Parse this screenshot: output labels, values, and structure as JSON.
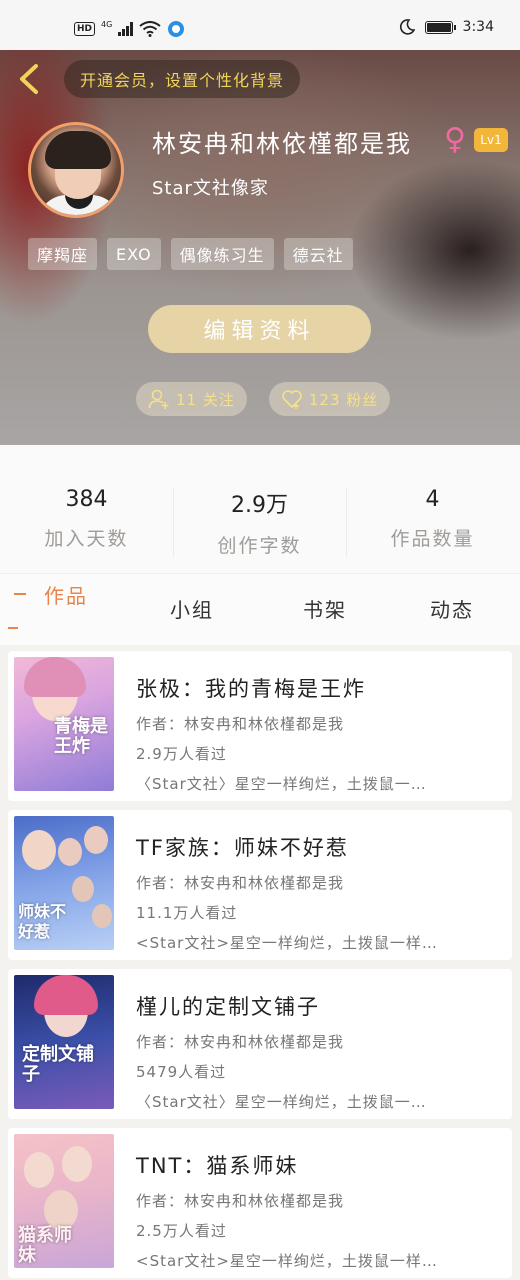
{
  "status_bar": {
    "hd": "HD",
    "network": "4G",
    "time": "3:34"
  },
  "header": {
    "vip_prompt": "开通会员，设置个性化背景",
    "name": "林安冉和林依槿都是我",
    "gender_symbol": "♀",
    "level": "Lv1",
    "subtitle": "Star文社像家",
    "tags": [
      "摩羯座",
      "EXO",
      "偶像练习生",
      "德云社"
    ],
    "edit_button": "编辑资料",
    "following": "11 关注",
    "followers": "123 粉丝"
  },
  "stats": [
    {
      "value": "384",
      "label": "加入天数"
    },
    {
      "value": "2.9万",
      "label": "创作字数"
    },
    {
      "value": "4",
      "label": "作品数量"
    }
  ],
  "tabs": [
    "作品",
    "小组",
    "书架",
    "动态"
  ],
  "works": [
    {
      "title": "张极：我的青梅是王炸",
      "author": "作者：林安冉和林依槿都是我",
      "views": "2.9万人看过",
      "desc": "〈Star文社〉星空一样绚烂，土拨鼠一…",
      "cover_text": "青梅是王炸"
    },
    {
      "title": "TF家族：师妹不好惹",
      "author": "作者：林安冉和林依槿都是我",
      "views": "11.1万人看过",
      "desc": "<Star文社>星空一样绚烂，土拨鼠一样…",
      "cover_text": "师妹不好惹"
    },
    {
      "title": "槿儿的定制文铺子",
      "author": "作者：林安冉和林依槿都是我",
      "views": "5479人看过",
      "desc": "〈Star文社〉星空一样绚烂，土拨鼠一…",
      "cover_text": "定制文铺子"
    },
    {
      "title": "TNT：猫系师妹",
      "author": "作者：林安冉和林依槿都是我",
      "views": "2.5万人看过",
      "desc": "<Star文社>星空一样绚烂，土拨鼠一样…",
      "cover_text": "猫系师妹"
    }
  ],
  "colors": {
    "accent": "#e7864c",
    "vip_text": "#f1d55a",
    "edit_button": "#e6d3a6",
    "level_badge": "#f2b63a"
  }
}
